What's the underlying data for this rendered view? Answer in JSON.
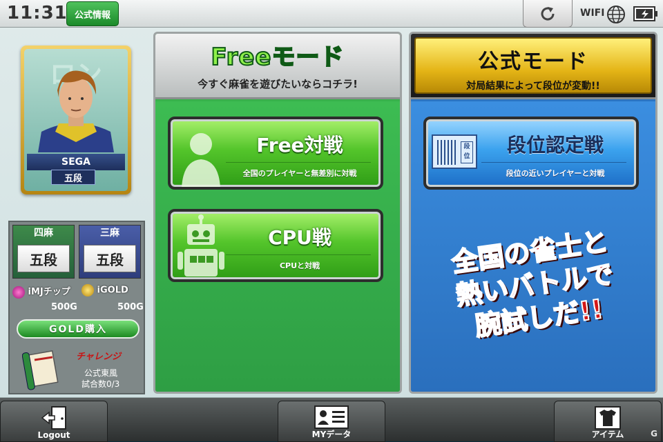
{
  "status_bar": {
    "time": "11:31",
    "official_info_label": "公式情報",
    "wifi_label": "WIFI",
    "refresh_icon": "refresh-icon",
    "globe_icon": "globe-icon",
    "battery_icon": "battery-icon"
  },
  "player": {
    "name": "SEGA",
    "rank": "五段",
    "yonma_label": "四麻",
    "yonma_rank": "五段",
    "sanma_label": "三麻",
    "sanma_rank": "五段",
    "mj_chip_label": "iMJチップ",
    "mj_chip_amount": "500G",
    "gold_label": "iGOLD",
    "gold_amount": "500G",
    "gold_buy_label": "GOLD購入",
    "challenge_label": "チャレンジ",
    "challenge_line1": "公式東風",
    "challenge_line2": "試合数0/3"
  },
  "free_mode": {
    "title": "Freeモード",
    "subtitle": "今すぐ麻雀を遊びたいならコチラ!",
    "buttons": [
      {
        "title": "Free対戦",
        "subtitle": "全国のプレイヤーと無差別に対戦"
      },
      {
        "title": "CPU戦",
        "subtitle": "CPUと対戦"
      }
    ]
  },
  "official_mode": {
    "title": "公式モード",
    "subtitle": "対局結果によって段位が変動!!",
    "buttons": [
      {
        "title": "段位認定戦",
        "subtitle": "段位の近いプレイヤーと対戦",
        "icon_text": "段位"
      }
    ],
    "promo_line1": "全国の雀士と",
    "promo_line2": "熱いバトルで",
    "promo_line3": "腕試しだ!!"
  },
  "bottom_nav": {
    "logout_label": "Logout",
    "mydata_label": "MYデータ",
    "item_label": "アイテム"
  },
  "watermark": "G"
}
